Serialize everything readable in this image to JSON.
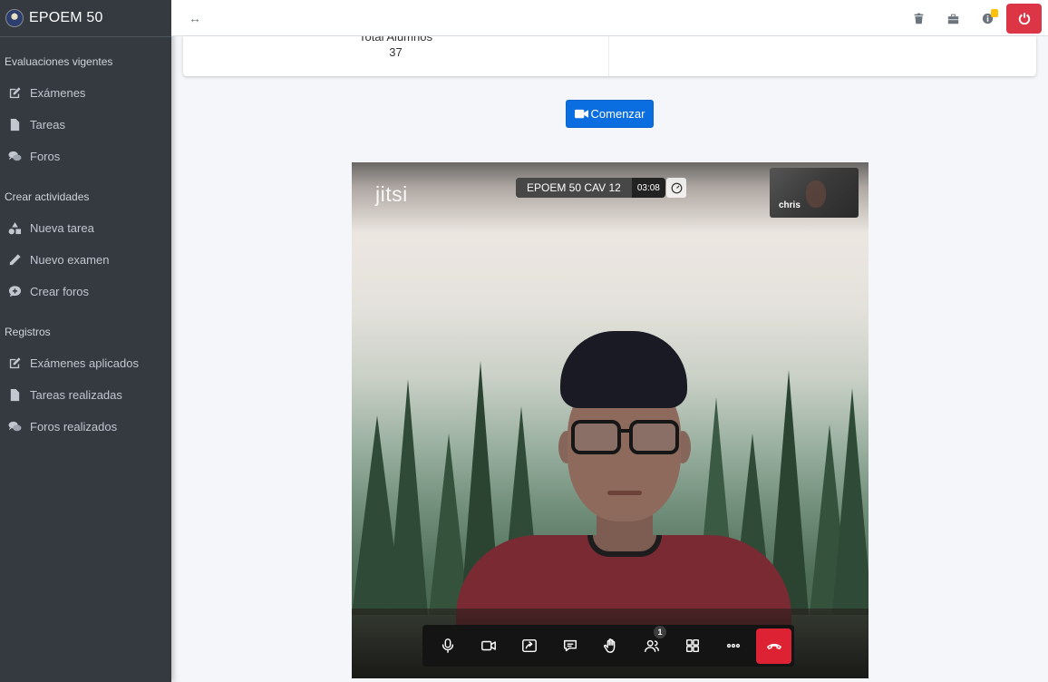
{
  "brand": {
    "name": "EPOEM 50"
  },
  "sidebar": {
    "sections": [
      {
        "header": "Evaluaciones vigentes",
        "items": [
          {
            "label": "Exámenes",
            "icon": "edit-icon"
          },
          {
            "label": "Tareas",
            "icon": "file-icon"
          },
          {
            "label": "Foros",
            "icon": "comments-icon"
          }
        ]
      },
      {
        "header": "Crear actividades",
        "items": [
          {
            "label": "Nueva tarea",
            "icon": "shapes-icon"
          },
          {
            "label": "Nuevo examen",
            "icon": "pencil-icon"
          },
          {
            "label": "Crear foros",
            "icon": "comment-plus-icon"
          }
        ]
      },
      {
        "header": "Registros",
        "items": [
          {
            "label": "Exámenes aplicados",
            "icon": "edit-icon"
          },
          {
            "label": "Tareas realizadas",
            "icon": "file-icon"
          },
          {
            "label": "Foros realizados",
            "icon": "comments-icon"
          }
        ]
      }
    ]
  },
  "navbar": {
    "toggle_glyph": "↔",
    "icons": [
      "trash-icon",
      "toolbox-icon",
      "info-icon",
      "power-icon"
    ]
  },
  "card": {
    "label": "Total Alumnos",
    "value": "37"
  },
  "start_button": {
    "label": "Comenzar"
  },
  "jitsi": {
    "logo": "jitsi",
    "meeting_name": "EPOEM 50 CAV 12",
    "timer": "03:08",
    "thumbnail_name": "chris",
    "participants_badge": "1"
  },
  "colors": {
    "sidebar": "#343a40",
    "primary": "#0b6ee0",
    "danger": "#dc3545",
    "warning": "#ffc107"
  }
}
